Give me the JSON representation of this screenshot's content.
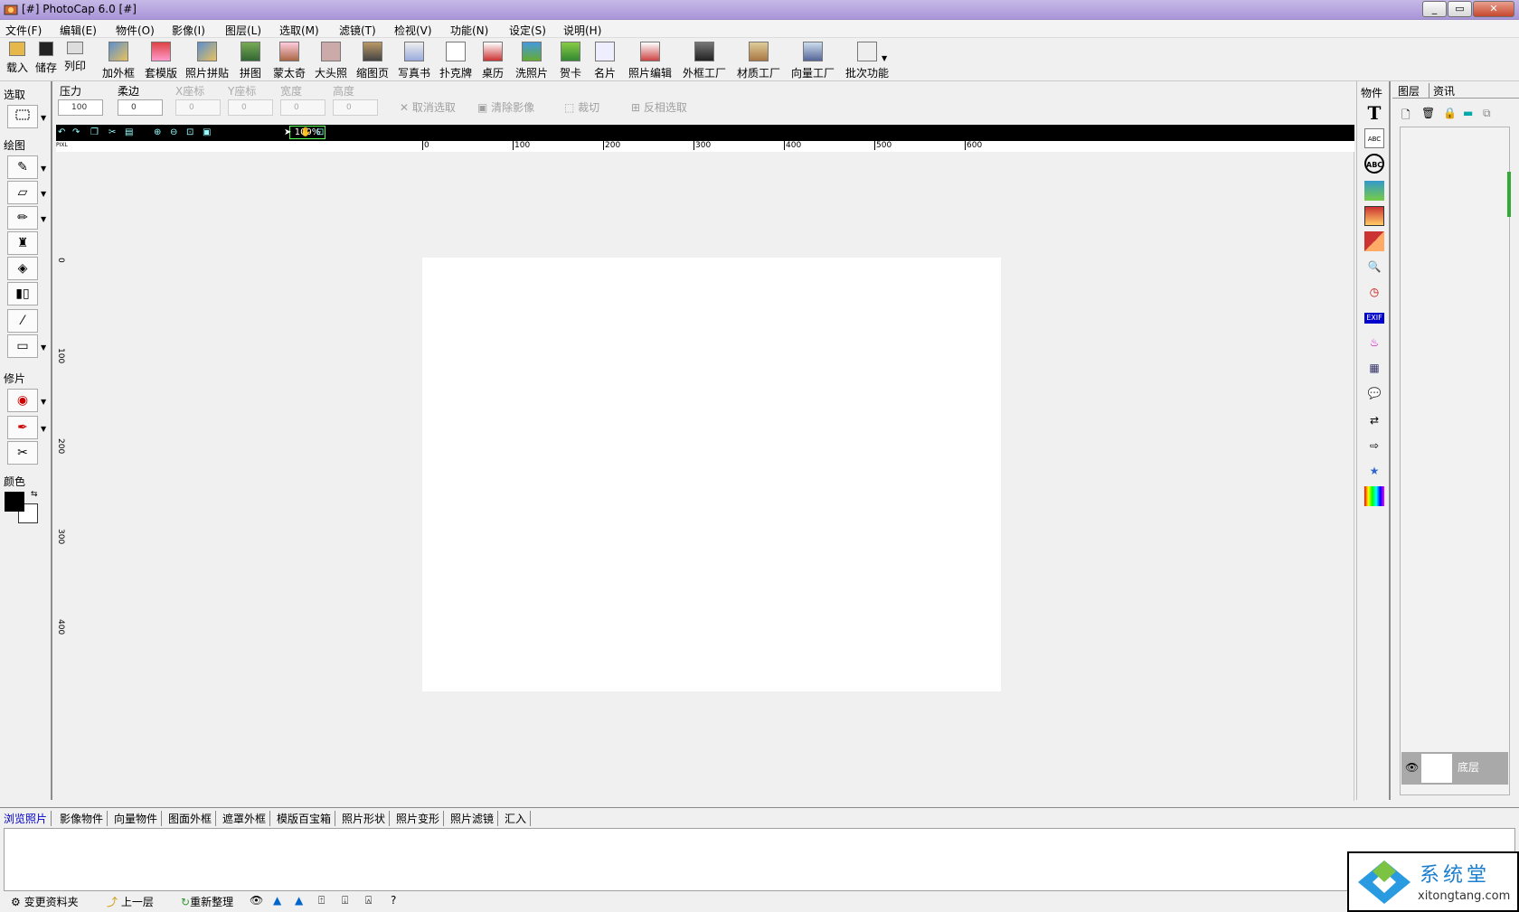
{
  "window": {
    "title": "[#] PhotoCap 6.0 [#]"
  },
  "menu": [
    "文件(F)",
    "编辑(E)",
    "物件(O)",
    "影像(I)",
    "图层(L)",
    "选取(M)",
    "滤镜(T)",
    "检视(V)",
    "功能(N)",
    "设定(S)",
    "说明(H)"
  ],
  "toolbar": [
    "载入",
    "储存",
    "列印",
    "加外框",
    "套模版",
    "照片拼贴",
    "拼图",
    "蒙太奇",
    "大头照",
    "缩图页",
    "写真书",
    "扑克牌",
    "桌历",
    "洗照片",
    "贺卡",
    "名片",
    "照片编辑",
    "外框工厂",
    "材质工厂",
    "向量工厂",
    "批次功能"
  ],
  "options": {
    "pressure_label": "压力",
    "pressure_value": "100",
    "feather_label": "柔边",
    "feather_value": "0",
    "x_label": "X座标",
    "x_value": "0",
    "y_label": "Y座标",
    "y_value": "0",
    "width_label": "宽度",
    "width_value": "0",
    "height_label": "高度",
    "height_value": "0",
    "unit": "PIXL",
    "deselect": "取消选取",
    "clear_image": "清除影像",
    "crop": "裁切",
    "invert_select": "反相选取"
  },
  "left_sections": {
    "select": "选取",
    "draw": "绘图",
    "retouch": "修片",
    "color": "颜色"
  },
  "view": {
    "zoom": "100%",
    "ruler_unit": "PIXL"
  },
  "ruler": {
    "h_ticks": [
      "0",
      "100",
      "200",
      "300",
      "400",
      "500",
      "600"
    ],
    "v_ticks": [
      "0",
      "100",
      "200",
      "300",
      "400"
    ]
  },
  "objects_panel": {
    "title": "物件"
  },
  "layer_panel": {
    "tab_layer": "图层",
    "tab_info": "资讯",
    "layer_name": "底层"
  },
  "bottom_tabs": [
    "浏览照片",
    "影像物件",
    "向量物件",
    "图面外框",
    "遮罩外框",
    "模版百宝箱",
    "照片形状",
    "照片变形",
    "照片滤镜",
    "汇入"
  ],
  "bottom_bar": {
    "change_folder": "变更资料夹",
    "up_level": "上一层",
    "refresh": "重新整理"
  },
  "watermark": {
    "text": "系统堂",
    "url": "xitongtang.com"
  }
}
